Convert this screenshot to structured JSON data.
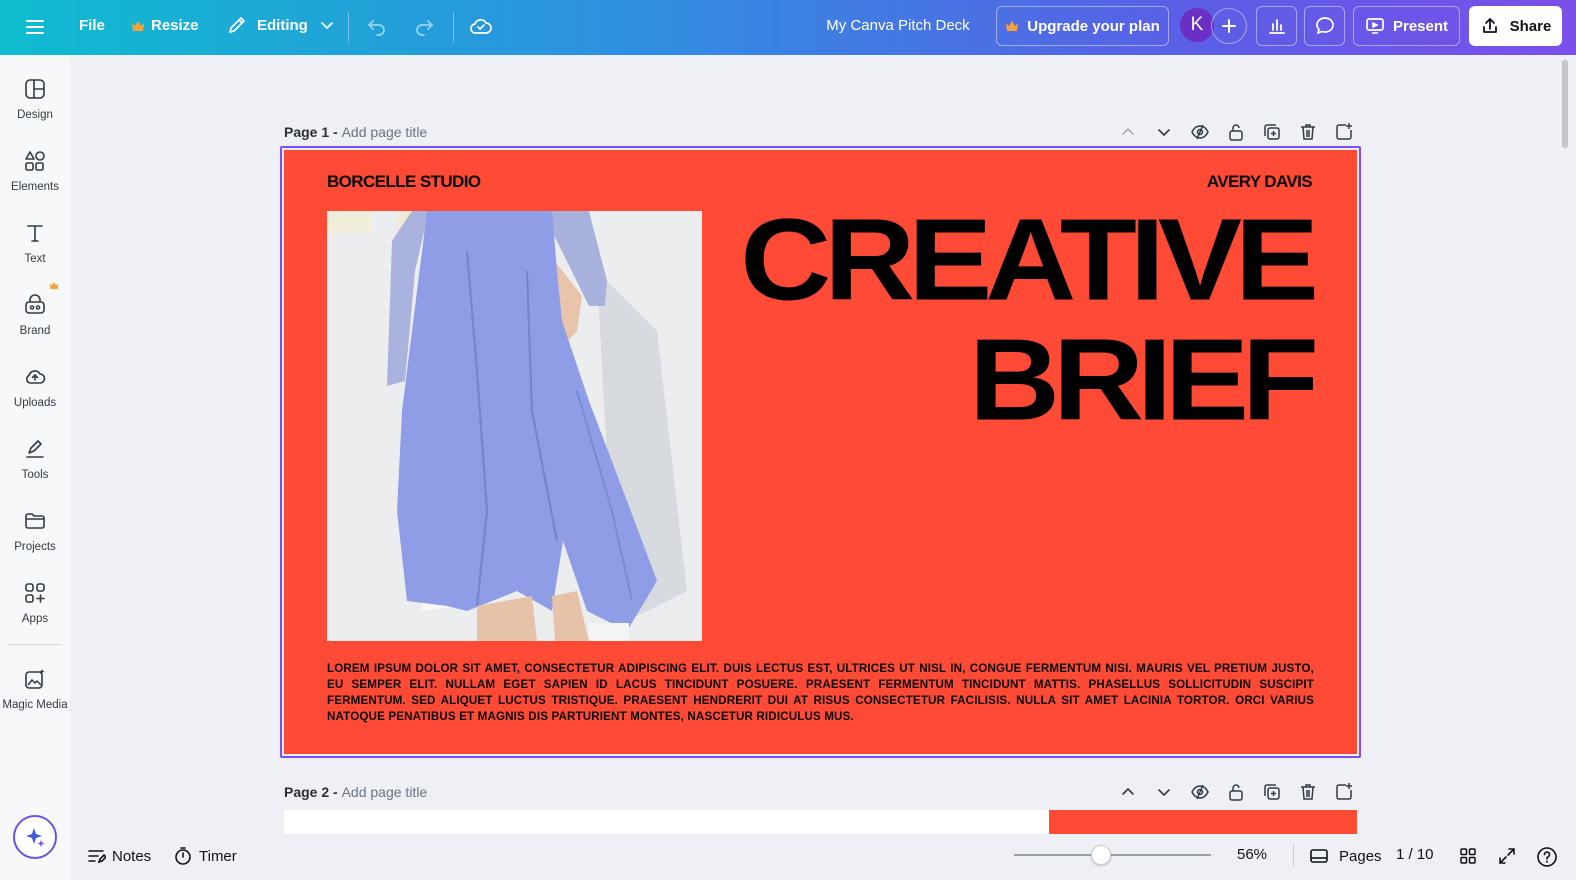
{
  "topbar": {
    "menu_icon": "hamburger-icon",
    "file_label": "File",
    "resize_label": "Resize",
    "editing_label": "Editing",
    "doc_title": "My Canva Pitch Deck",
    "upgrade_label": "Upgrade your plan",
    "avatar_initial": "K",
    "present_label": "Present",
    "share_label": "Share",
    "crown_color": "#f7a23a"
  },
  "sidebar": {
    "items": [
      {
        "label": "Design",
        "icon": "layout-icon"
      },
      {
        "label": "Elements",
        "icon": "shapes-icon"
      },
      {
        "label": "Text",
        "icon": "text-icon"
      },
      {
        "label": "Brand",
        "icon": "brand-icon"
      },
      {
        "label": "Uploads",
        "icon": "cloud-upload-icon"
      },
      {
        "label": "Tools",
        "icon": "pen-tool-icon"
      },
      {
        "label": "Projects",
        "icon": "folder-icon"
      },
      {
        "label": "Apps",
        "icon": "apps-icon"
      },
      {
        "label": "Magic Media",
        "icon": "magic-media-icon"
      }
    ]
  },
  "pages": [
    {
      "label": "Page 1 -",
      "title_placeholder": "Add page title"
    },
    {
      "label": "Page 2 -",
      "title_placeholder": "Add page title"
    }
  ],
  "slide": {
    "brand": "BORCELLE STUDIO",
    "author": "AVERY DAVIS",
    "headline_line1": "CREATIVE",
    "headline_line2": "BRIEF",
    "body": "LOREM IPSUM DOLOR SIT AMET, CONSECTETUR ADIPISCING ELIT. DUIS LECTUS EST, ULTRICES UT NISL IN, CONGUE FERMENTUM NISI. MAURIS VEL PRETIUM JUSTO, EU SEMPER ELIT. NULLAM EGET SAPIEN ID LACUS TINCIDUNT POSUERE. PRAESENT FERMENTUM TINCIDUNT MATTIS. PHASELLUS SOLLICITUDIN SUSCIPIT FERMENTUM. SED ALIQUET LUCTUS TRISTIQUE. PRAESENT HENDRERIT DUI AT RISUS CONSECTETUR FACILISIS. NULLA SIT AMET LACINIA TORTOR. ORCI VARIUS NATOQUE PENATIBUS ET MAGNIS DIS PARTURIENT MONTES, NASCETUR RIDICULUS MUS.",
    "background_color": "#ff4a35"
  },
  "bottombar": {
    "notes_label": "Notes",
    "timer_label": "Timer",
    "zoom_label": "56%",
    "zoom_level": 0.56,
    "pages_label": "Pages",
    "page_counter": "1 / 10"
  }
}
